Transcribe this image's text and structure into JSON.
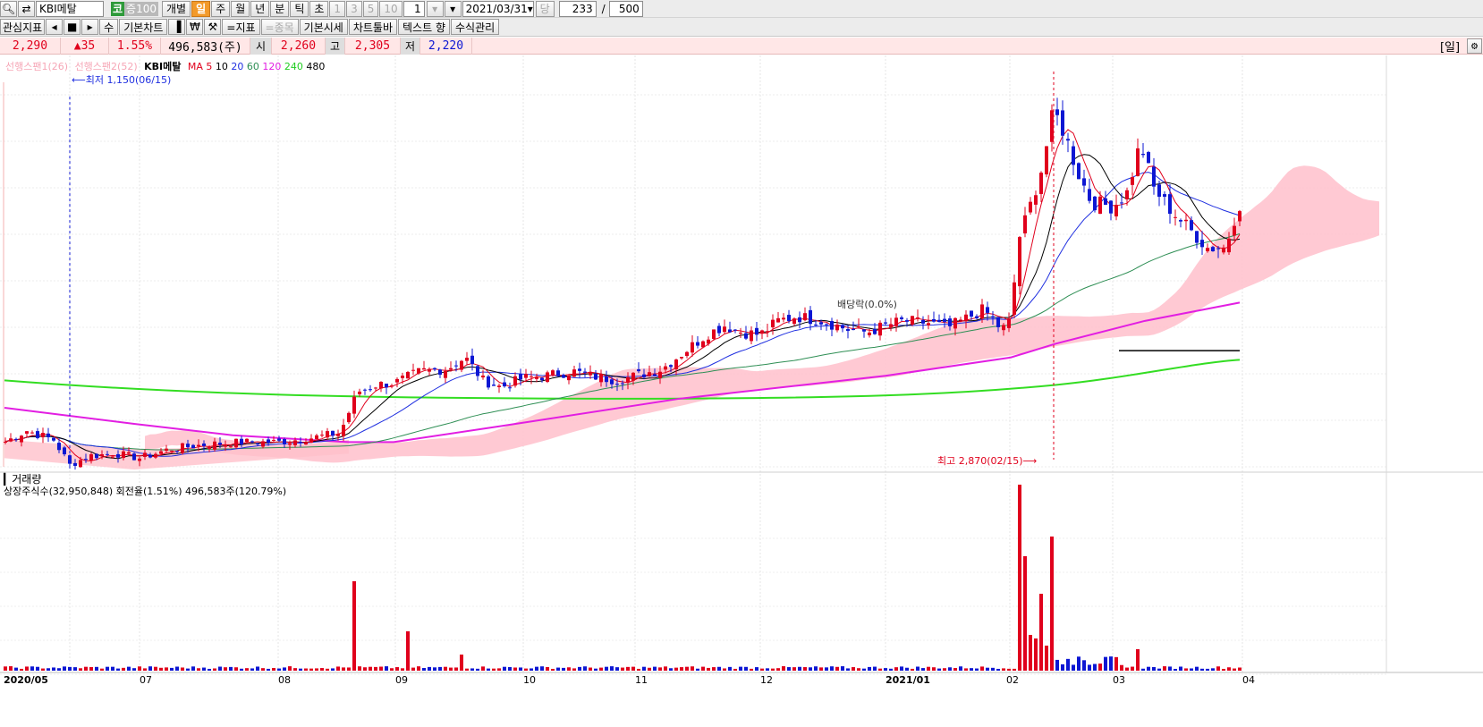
{
  "toolbar": {
    "stock_name": "KBI메탈",
    "market_badge": "코",
    "margin_badge": "증100",
    "individual_label": "개별",
    "periods": [
      "일",
      "주",
      "월",
      "년",
      "분",
      "틱",
      "초"
    ],
    "active_period": "일",
    "intervals": [
      "1",
      "3",
      "5",
      "10"
    ],
    "count_value": "1",
    "date_value": "2021/03/31",
    "date_suffix": "당",
    "bars_shown": "233",
    "slash": "/",
    "bars_total": "500"
  },
  "toolbar2": {
    "interest_label": "관심지표",
    "stepper_label": "수",
    "basic_chart": "기본차트",
    "indicator": "=지표",
    "item": "=종목",
    "basic_market": "기본시세",
    "chart_toolbar": "차트툴바",
    "text_label": "텍스트 향",
    "formula_mgmt": "수식관리"
  },
  "price": {
    "current": "2,290",
    "change": "▲35",
    "change_pct": "1.55%",
    "volume": "496,583(주)",
    "open_label": "시",
    "open": "2,260",
    "high_label": "고",
    "high": "2,305",
    "low_label": "저",
    "low": "2,220",
    "period_tag": "[일]"
  },
  "legend": {
    "span1": "선행스팬1(26)",
    "span2": "선행스팬2(52)",
    "name": "KBI메탈",
    "ma_label": "MA",
    "ma_periods": [
      "5",
      "10",
      "20",
      "60",
      "120",
      "240",
      "480"
    ]
  },
  "annotations": {
    "low_marker": "최저 1,150(06/15)",
    "high_marker": "최고 2,870(02/15)",
    "dividend": "배당락(0.0%)"
  },
  "volume_panel": {
    "title": "거래량",
    "info": "상장주식수(32,950,848) 회전율(1.51%) 496,583주(120.79%)"
  },
  "x_axis": {
    "labels": [
      "2020/05",
      "07",
      "08",
      "09",
      "10",
      "11",
      "12",
      "2021/01",
      "02",
      "03",
      "04"
    ],
    "bold": [
      "2020/05",
      "2021/01"
    ]
  },
  "colors": {
    "up": "#e0001c",
    "down": "#0d17d3",
    "cloud": "#ffc0cb",
    "ma5": "#e0001c",
    "ma10": "#000000",
    "ma20": "#1f2fe0",
    "ma60": "#2f8f55",
    "ma120": "#e21ee2",
    "ma240": "#33dd22",
    "ma480": "#000000"
  },
  "chart_data": {
    "type": "candlestick",
    "x_start": "2020/05",
    "x_end": "2021/03/31",
    "ylim": [
      1150,
      2870
    ],
    "price_markers": {
      "low": {
        "value": 1150,
        "date": "06/15"
      },
      "high": {
        "value": 2870,
        "date": "02/15"
      }
    },
    "last": {
      "open": 2260,
      "high": 2305,
      "low": 2220,
      "close": 2290
    }
  }
}
